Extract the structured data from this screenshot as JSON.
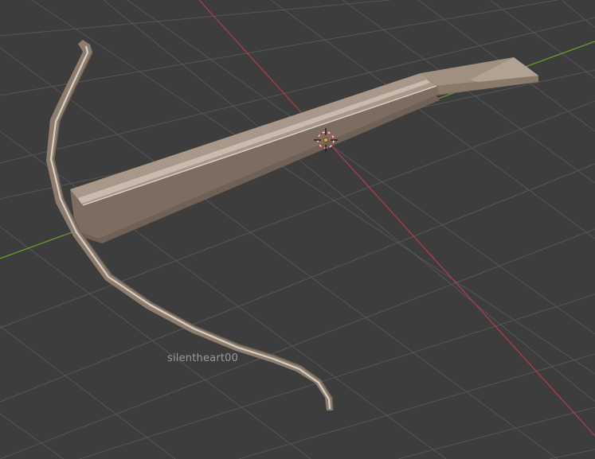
{
  "viewport": {
    "background_color": "#3d3d3d",
    "grid_color": "#555555",
    "x_axis_color": "#b13a4a",
    "y_axis_color": "#6a9a2a"
  },
  "object": {
    "type": "crossbow",
    "material_color": "#a0907f",
    "highlight_color": "#d6ccbf",
    "shadow_color": "#6f6155"
  },
  "origin": {
    "icon": "object-origin-icon",
    "color": "#f29a2e"
  },
  "cursor": {
    "icon": "3d-cursor-icon"
  },
  "watermark": {
    "text": "silentheart00"
  }
}
